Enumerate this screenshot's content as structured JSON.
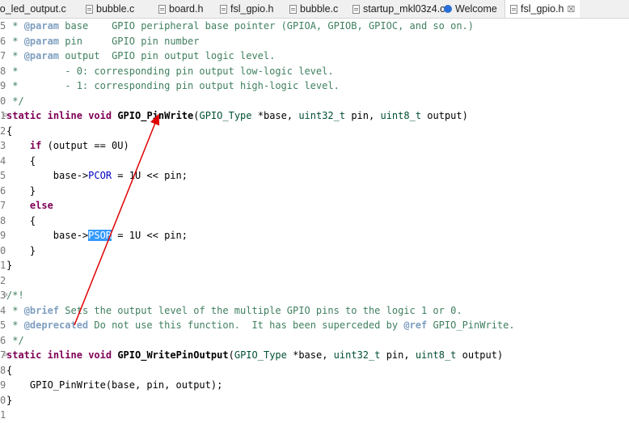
{
  "tabs": [
    {
      "label": "io_led_output.c",
      "icon": "none"
    },
    {
      "label": "bubble.c",
      "icon": "file-icon"
    },
    {
      "label": "board.h",
      "icon": "file-icon"
    },
    {
      "label": "fsl_gpio.h",
      "icon": "file-icon"
    },
    {
      "label": "bubble.c",
      "icon": "file-icon"
    },
    {
      "label": "startup_mkl03z4.c",
      "icon": "file-icon"
    },
    {
      "label": "Welcome",
      "icon": "globe-icon"
    },
    {
      "label": "fsl_gpio.h",
      "icon": "file-icon",
      "active": true,
      "close": "☒"
    }
  ],
  "lines": [
    {
      "n": "5",
      "t": " * @param base    GPIO peripheral base pointer (GPIOA, GPIOB, GPIOC, and so on.)"
    },
    {
      "n": "6",
      "t": " * @param pin     GPIO pin number"
    },
    {
      "n": "7",
      "t": " * @param output  GPIO pin output logic level."
    },
    {
      "n": "8",
      "t": " *        - 0: corresponding pin output low-logic level."
    },
    {
      "n": "9",
      "t": " *        - 1: corresponding pin output high-logic level."
    },
    {
      "n": "0",
      "t": " */"
    },
    {
      "n": "1",
      "t": "static inline void GPIO_PinWrite(GPIO_Type *base, uint32_t pin, uint8_t output)"
    },
    {
      "n": "2",
      "t": "{"
    },
    {
      "n": "3",
      "t": "    if (output == 0U)"
    },
    {
      "n": "4",
      "t": "    {"
    },
    {
      "n": "5",
      "t": "        base->PCOR = 1U << pin;"
    },
    {
      "n": "6",
      "t": "    }"
    },
    {
      "n": "7",
      "t": "    else"
    },
    {
      "n": "8",
      "t": "    {"
    },
    {
      "n": "9",
      "t": "        base->PSOR = 1U << pin;"
    },
    {
      "n": "0",
      "t": "    }"
    },
    {
      "n": "1",
      "t": "}"
    },
    {
      "n": "2",
      "t": ""
    },
    {
      "n": "3",
      "t": "/*!"
    },
    {
      "n": "4",
      "t": " * @brief Sets the output level of the multiple GPIO pins to the logic 1 or 0."
    },
    {
      "n": "5",
      "t": " * @deprecated Do not use this function.  It has been superceded by @ref GPIO_PinWrite."
    },
    {
      "n": "6",
      "t": " */"
    },
    {
      "n": "7",
      "t": "static inline void GPIO_WritePinOutput(GPIO_Type *base, uint32_t pin, uint8_t output)"
    },
    {
      "n": "8",
      "t": "{"
    },
    {
      "n": "9",
      "t": "    GPIO_PinWrite(base, pin, output);"
    },
    {
      "n": "0",
      "t": "}"
    },
    {
      "n": "1",
      "t": ""
    }
  ],
  "colors": {
    "annotation_arrow": "#e00000",
    "selection": "#3399ff",
    "keyword": "#7f0055",
    "comment": "#3f7f5f",
    "field": "#0000c0"
  }
}
